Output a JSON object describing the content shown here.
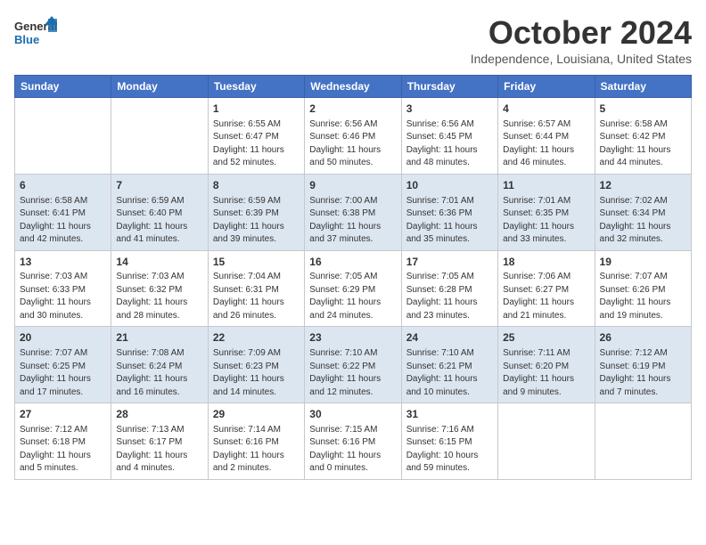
{
  "header": {
    "logo_general": "General",
    "logo_blue": "Blue",
    "month": "October 2024",
    "location": "Independence, Louisiana, United States"
  },
  "weekdays": [
    "Sunday",
    "Monday",
    "Tuesday",
    "Wednesday",
    "Thursday",
    "Friday",
    "Saturday"
  ],
  "weeks": [
    [
      {
        "day": "",
        "info": ""
      },
      {
        "day": "",
        "info": ""
      },
      {
        "day": "1",
        "info": "Sunrise: 6:55 AM\nSunset: 6:47 PM\nDaylight: 11 hours and 52 minutes."
      },
      {
        "day": "2",
        "info": "Sunrise: 6:56 AM\nSunset: 6:46 PM\nDaylight: 11 hours and 50 minutes."
      },
      {
        "day": "3",
        "info": "Sunrise: 6:56 AM\nSunset: 6:45 PM\nDaylight: 11 hours and 48 minutes."
      },
      {
        "day": "4",
        "info": "Sunrise: 6:57 AM\nSunset: 6:44 PM\nDaylight: 11 hours and 46 minutes."
      },
      {
        "day": "5",
        "info": "Sunrise: 6:58 AM\nSunset: 6:42 PM\nDaylight: 11 hours and 44 minutes."
      }
    ],
    [
      {
        "day": "6",
        "info": "Sunrise: 6:58 AM\nSunset: 6:41 PM\nDaylight: 11 hours and 42 minutes."
      },
      {
        "day": "7",
        "info": "Sunrise: 6:59 AM\nSunset: 6:40 PM\nDaylight: 11 hours and 41 minutes."
      },
      {
        "day": "8",
        "info": "Sunrise: 6:59 AM\nSunset: 6:39 PM\nDaylight: 11 hours and 39 minutes."
      },
      {
        "day": "9",
        "info": "Sunrise: 7:00 AM\nSunset: 6:38 PM\nDaylight: 11 hours and 37 minutes."
      },
      {
        "day": "10",
        "info": "Sunrise: 7:01 AM\nSunset: 6:36 PM\nDaylight: 11 hours and 35 minutes."
      },
      {
        "day": "11",
        "info": "Sunrise: 7:01 AM\nSunset: 6:35 PM\nDaylight: 11 hours and 33 minutes."
      },
      {
        "day": "12",
        "info": "Sunrise: 7:02 AM\nSunset: 6:34 PM\nDaylight: 11 hours and 32 minutes."
      }
    ],
    [
      {
        "day": "13",
        "info": "Sunrise: 7:03 AM\nSunset: 6:33 PM\nDaylight: 11 hours and 30 minutes."
      },
      {
        "day": "14",
        "info": "Sunrise: 7:03 AM\nSunset: 6:32 PM\nDaylight: 11 hours and 28 minutes."
      },
      {
        "day": "15",
        "info": "Sunrise: 7:04 AM\nSunset: 6:31 PM\nDaylight: 11 hours and 26 minutes."
      },
      {
        "day": "16",
        "info": "Sunrise: 7:05 AM\nSunset: 6:29 PM\nDaylight: 11 hours and 24 minutes."
      },
      {
        "day": "17",
        "info": "Sunrise: 7:05 AM\nSunset: 6:28 PM\nDaylight: 11 hours and 23 minutes."
      },
      {
        "day": "18",
        "info": "Sunrise: 7:06 AM\nSunset: 6:27 PM\nDaylight: 11 hours and 21 minutes."
      },
      {
        "day": "19",
        "info": "Sunrise: 7:07 AM\nSunset: 6:26 PM\nDaylight: 11 hours and 19 minutes."
      }
    ],
    [
      {
        "day": "20",
        "info": "Sunrise: 7:07 AM\nSunset: 6:25 PM\nDaylight: 11 hours and 17 minutes."
      },
      {
        "day": "21",
        "info": "Sunrise: 7:08 AM\nSunset: 6:24 PM\nDaylight: 11 hours and 16 minutes."
      },
      {
        "day": "22",
        "info": "Sunrise: 7:09 AM\nSunset: 6:23 PM\nDaylight: 11 hours and 14 minutes."
      },
      {
        "day": "23",
        "info": "Sunrise: 7:10 AM\nSunset: 6:22 PM\nDaylight: 11 hours and 12 minutes."
      },
      {
        "day": "24",
        "info": "Sunrise: 7:10 AM\nSunset: 6:21 PM\nDaylight: 11 hours and 10 minutes."
      },
      {
        "day": "25",
        "info": "Sunrise: 7:11 AM\nSunset: 6:20 PM\nDaylight: 11 hours and 9 minutes."
      },
      {
        "day": "26",
        "info": "Sunrise: 7:12 AM\nSunset: 6:19 PM\nDaylight: 11 hours and 7 minutes."
      }
    ],
    [
      {
        "day": "27",
        "info": "Sunrise: 7:12 AM\nSunset: 6:18 PM\nDaylight: 11 hours and 5 minutes."
      },
      {
        "day": "28",
        "info": "Sunrise: 7:13 AM\nSunset: 6:17 PM\nDaylight: 11 hours and 4 minutes."
      },
      {
        "day": "29",
        "info": "Sunrise: 7:14 AM\nSunset: 6:16 PM\nDaylight: 11 hours and 2 minutes."
      },
      {
        "day": "30",
        "info": "Sunrise: 7:15 AM\nSunset: 6:16 PM\nDaylight: 11 hours and 0 minutes."
      },
      {
        "day": "31",
        "info": "Sunrise: 7:16 AM\nSunset: 6:15 PM\nDaylight: 10 hours and 59 minutes."
      },
      {
        "day": "",
        "info": ""
      },
      {
        "day": "",
        "info": ""
      }
    ]
  ]
}
